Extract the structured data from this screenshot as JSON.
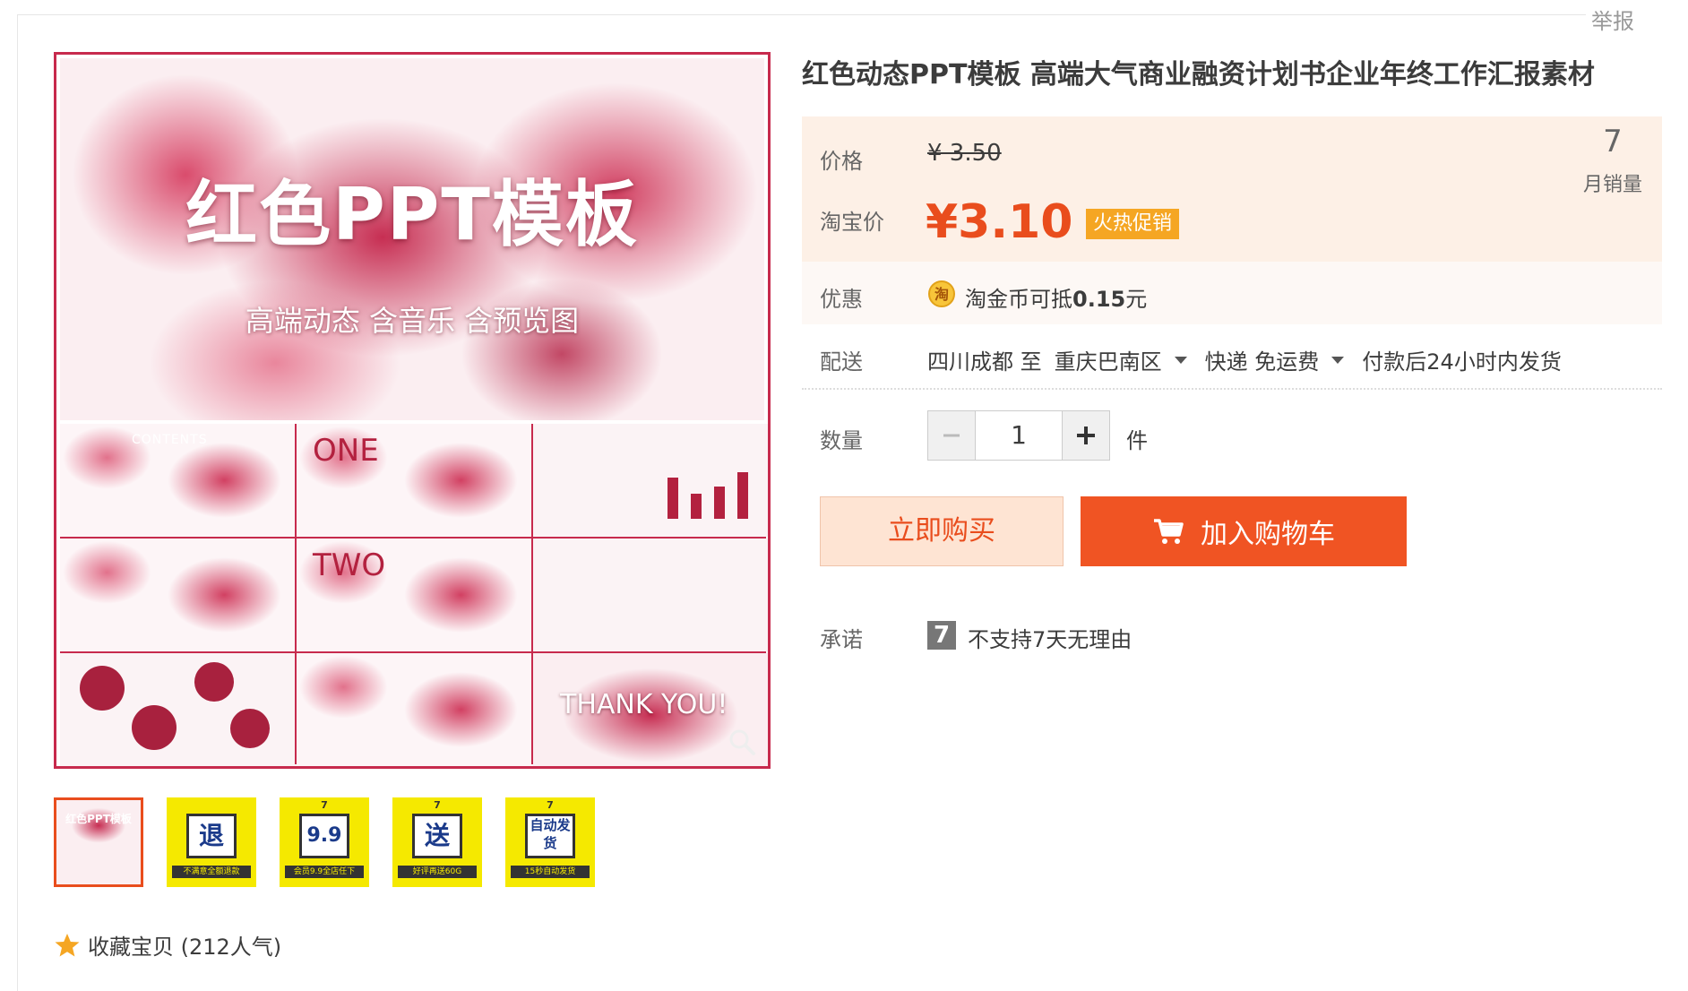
{
  "header": {
    "report_label": "举报"
  },
  "gallery": {
    "hero_title": "红色PPT模板",
    "hero_subtitle": "高端动态 含音乐 含预览图",
    "slide_labels": {
      "contents": "CONTENTS",
      "one": "ONE",
      "two": "TWO",
      "thanks": "THANK YOU!"
    },
    "thumbnails": [
      {
        "name": "main-preview",
        "glyph": "",
        "caption": "",
        "mini_title": "红色PPT模板"
      },
      {
        "name": "refund",
        "glyph": "退",
        "caption": "不满意全额退款",
        "top": ""
      },
      {
        "name": "vip",
        "glyph": "9.9",
        "caption": "会员9.9全店任下",
        "top": "7"
      },
      {
        "name": "gift",
        "glyph": "送",
        "caption": "好评再送60G",
        "top": "7"
      },
      {
        "name": "auto",
        "glyph": "自动发货",
        "caption": "15秒自动发货",
        "top": "7"
      }
    ],
    "favorite_label": "收藏宝贝 (212人气)"
  },
  "product": {
    "title": "红色动态PPT模板 高端大气商业融资计划书企业年终工作汇报素材",
    "price_label": "价格",
    "original_price": "¥ 3.50",
    "taobao_price_label": "淘宝价",
    "current_price": "¥3.10",
    "promo_badge": "火热促销",
    "monthly_sales": "7",
    "monthly_sales_label": "月销量",
    "discount_label": "优惠",
    "discount_prefix": "淘金币可抵",
    "discount_amount": "0.15",
    "discount_suffix": "元",
    "delivery_label": "配送",
    "delivery_from": "四川成都 至",
    "delivery_to": "重庆巴南区",
    "shipping": "快递 免运费",
    "ship_time": "付款后24小时内发货",
    "quantity_label": "数量",
    "quantity": "1",
    "unit": "件",
    "buy_now": "立即购买",
    "add_to_cart": "加入购物车",
    "promise_label": "承诺",
    "promise_text": "不支持7天无理由"
  },
  "colors": {
    "accent": "#e94d1d",
    "cart_button": "#f05423",
    "promo_badge": "#f5a623",
    "price_box": "#fdf0e6"
  }
}
